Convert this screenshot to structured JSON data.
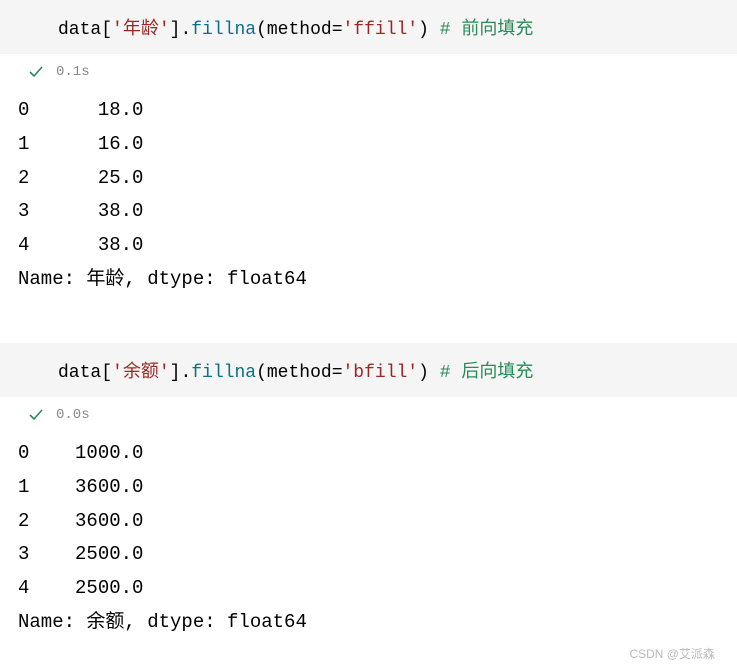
{
  "cells": [
    {
      "code": {
        "var": "data",
        "col": "'年龄'",
        "method": "fillna",
        "arg_key": "method",
        "arg_val": "'ffill'",
        "comment": "# 前向填充"
      },
      "status": {
        "time": "0.1s"
      },
      "output": {
        "rows": [
          {
            "idx": "0",
            "val": "18.0"
          },
          {
            "idx": "1",
            "val": "16.0"
          },
          {
            "idx": "2",
            "val": "25.0"
          },
          {
            "idx": "3",
            "val": "38.0"
          },
          {
            "idx": "4",
            "val": "38.0"
          }
        ],
        "footer": "Name: 年龄, dtype: float64"
      }
    },
    {
      "code": {
        "var": "data",
        "col": "'余额'",
        "method": "fillna",
        "arg_key": "method",
        "arg_val": "'bfill'",
        "comment": "# 后向填充"
      },
      "status": {
        "time": "0.0s"
      },
      "output": {
        "rows": [
          {
            "idx": "0",
            "val": "1000.0"
          },
          {
            "idx": "1",
            "val": "3600.0"
          },
          {
            "idx": "2",
            "val": "3600.0"
          },
          {
            "idx": "3",
            "val": "2500.0"
          },
          {
            "idx": "4",
            "val": "2500.0"
          }
        ],
        "footer": "Name: 余额, dtype: float64"
      }
    }
  ],
  "watermark": "CSDN @艾派森"
}
